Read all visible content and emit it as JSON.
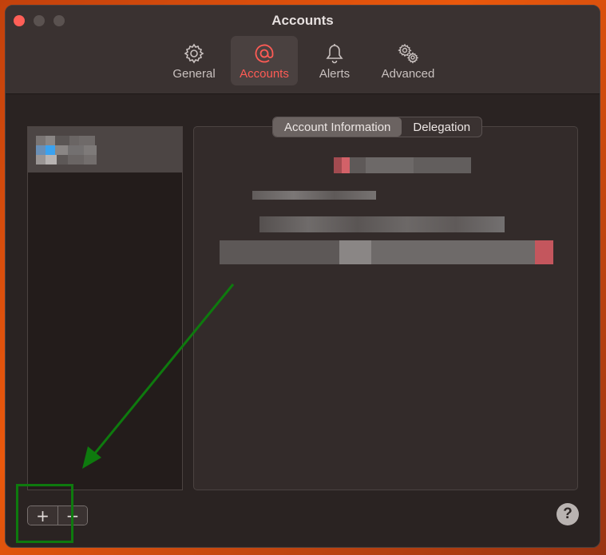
{
  "window": {
    "title": "Accounts"
  },
  "toolbar": {
    "items": [
      {
        "label": "General",
        "icon": "gear-icon"
      },
      {
        "label": "Accounts",
        "icon": "at-icon",
        "active": true
      },
      {
        "label": "Alerts",
        "icon": "bell-icon"
      },
      {
        "label": "Advanced",
        "icon": "gears-icon"
      }
    ]
  },
  "tabs": {
    "account_information": "Account Information",
    "delegation": "Delegation"
  },
  "list_controls": {
    "add": "+",
    "remove": "−"
  },
  "help": {
    "label": "?"
  },
  "colors": {
    "accent": "#ff5b55",
    "annotation": "#0e7a0e"
  }
}
